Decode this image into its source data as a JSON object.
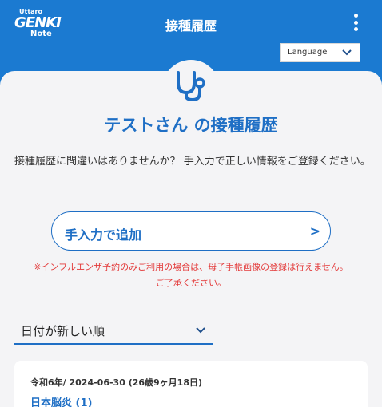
{
  "header": {
    "logo_top": "Uttaro",
    "logo_main": "GENKI",
    "logo_sub": "Note",
    "title": "接種履歴",
    "language_label": "Language"
  },
  "main": {
    "heading": "テストさん の接種履歴",
    "description": "接種履歴に間違いはありませんか？ 手入力で正しい情報をご登録ください。",
    "add_button_label": "手入力で追加",
    "add_button_arrow": ">",
    "warning_line1": "※インフルエンザ予約のみご利用の場合は、母子手帳画像の登録は行えません。",
    "warning_line2": "ご了承ください。",
    "sort_selected": "日付が新しい順"
  },
  "records": [
    {
      "date": "令和6年/ 2024-06-30 (26歳9ヶ月18日)",
      "vaccine": "日本脳炎 (1)"
    }
  ],
  "colors": {
    "header_bg": "#1b7ad1",
    "accent": "#1f6fc5",
    "warning": "#e33a3a",
    "card_bg": "#f4f4f6"
  },
  "icons": [
    "logo-icon",
    "kebab-menu-icon",
    "chevron-down-icon",
    "stethoscope-icon"
  ]
}
